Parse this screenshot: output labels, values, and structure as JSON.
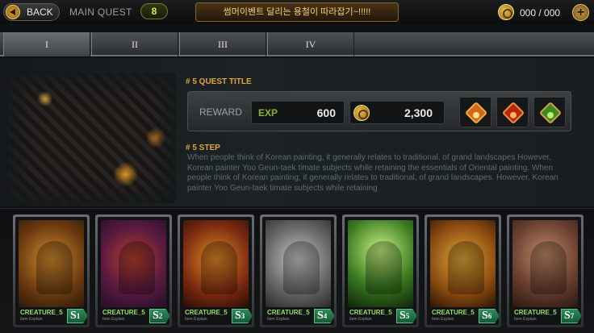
{
  "topbar": {
    "back_label": "BACK",
    "main_quest_label": "MAIN QUEST",
    "quest_count": "8",
    "notice": "썸머이벤트 달리는 용철이 따라잡기~!!!!!",
    "currency": "000 / 000",
    "plus_label": "+"
  },
  "tabs": [
    {
      "label": "I"
    },
    {
      "label": "II"
    },
    {
      "label": "III"
    },
    {
      "label": "IV"
    }
  ],
  "quest": {
    "title": "# 5 QUEST TITLE",
    "reward_label": "REWARD",
    "exp_label": "EXP",
    "exp_value": "600",
    "gold_value": "2,300",
    "gems": [
      "orange-gem-icon",
      "red-gem-icon",
      "green-gem-icon"
    ],
    "step_title": "# 5 STEP",
    "step_text": "When people think of Korean painting, it generally relates to traditional, of grand landscapes However, Korean painter Yoo Geun-taek  timate subjects while retaining the essentials of Oriental painting. When people think of Korean painting, it generally relates to traditional, of grand landscapes. However, Korean painter Yoo Geun-taek  timate subjects while retaining"
  },
  "cards": [
    {
      "name": "CREATURE_5",
      "sub": "Item Explain",
      "rank": "S",
      "num": "1"
    },
    {
      "name": "CREATURE_5",
      "sub": "Item Explain",
      "rank": "S",
      "num": "2"
    },
    {
      "name": "CREATURE_5",
      "sub": "Item Explain",
      "rank": "S",
      "num": "3"
    },
    {
      "name": "CREATURE_5",
      "sub": "Item Explain",
      "rank": "S",
      "num": "4"
    },
    {
      "name": "CREATURE_5",
      "sub": "Item Explain",
      "rank": "S",
      "num": "5"
    },
    {
      "name": "CREATURE_5",
      "sub": "Item Explain",
      "rank": "S",
      "num": "6"
    },
    {
      "name": "CREATURE_5",
      "sub": "Item Explain",
      "rank": "S",
      "num": "7"
    }
  ],
  "colors": {
    "accent": "#e0a53a",
    "exp": "#87b33a",
    "badge": "#2e8a5a"
  }
}
